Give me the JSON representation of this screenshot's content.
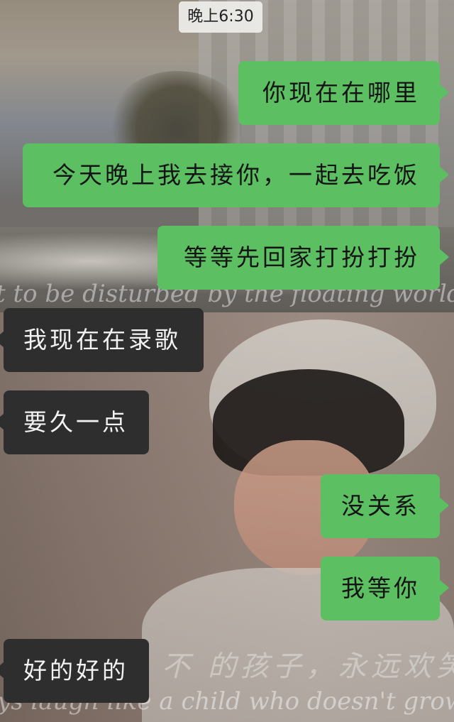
{
  "chat": {
    "timestamp": "晚上6:30",
    "messages": [
      {
        "side": "out",
        "text": "你现在在哪里"
      },
      {
        "side": "out",
        "text": "今天晚上我去接你，一起去吃饭"
      },
      {
        "side": "out",
        "text": "等等先回家打扮打扮"
      },
      {
        "side": "in",
        "text": "我现在在录歌"
      },
      {
        "side": "in",
        "text": "要久一点"
      },
      {
        "side": "out",
        "text": "没关系"
      },
      {
        "side": "out",
        "text": "我等你"
      },
      {
        "side": "in",
        "text": "好的好的"
      }
    ]
  },
  "wallpaper": {
    "caption_top": "t to be disturbed by the floating world",
    "caption_middle": "不 的孩子，永远欢笑",
    "caption_bottom": "ys laugh like a child who doesn't grow"
  },
  "colors": {
    "outgoing_bubble": "#5cbf62",
    "incoming_bubble": "#2e2e2e",
    "timestamp_badge": "#eeeeec"
  }
}
